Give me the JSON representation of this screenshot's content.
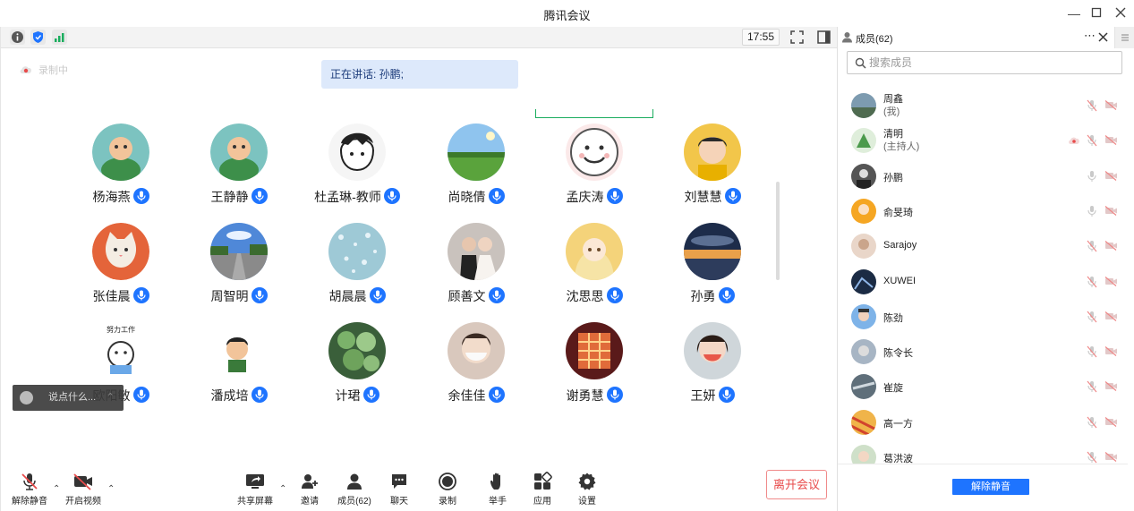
{
  "window": {
    "title": "腾讯会议"
  },
  "topstrip": {
    "time": "17:55"
  },
  "recording": {
    "label": "录制中"
  },
  "speaking": {
    "text": "正在讲话: 孙鹏;"
  },
  "colors": {
    "accent": "#1e74ff",
    "leave": "#e84a4a",
    "speaking_bg": "#dde9fb",
    "active_speaker_border": "#1aad5e"
  },
  "participants": [
    {
      "name": "杨海燕",
      "avatar": "avatar-cartoon-icon"
    },
    {
      "name": "王静静",
      "avatar": "avatar-cartoon-icon"
    },
    {
      "name": "杜孟琳-教师",
      "avatar": "avatar-sketch-icon"
    },
    {
      "name": "尚晓倩",
      "avatar": "avatar-landscape-icon"
    },
    {
      "name": "孟庆涛",
      "avatar": "avatar-smiley-icon"
    },
    {
      "name": "刘慧慧",
      "avatar": "avatar-child-photo-icon"
    },
    {
      "name": "张佳晨",
      "avatar": "avatar-cat-icon"
    },
    {
      "name": "周智明",
      "avatar": "avatar-road-icon"
    },
    {
      "name": "胡晨晨",
      "avatar": "avatar-texture-icon"
    },
    {
      "name": "顾善文",
      "avatar": "avatar-wedding-photo-icon"
    },
    {
      "name": "沈思思",
      "avatar": "avatar-anime-icon"
    },
    {
      "name": "孙勇",
      "avatar": "avatar-sunset-icon"
    },
    {
      "name": "欧阳敏",
      "avatar": "avatar-work-sticker-icon",
      "caption": "努力工作"
    },
    {
      "name": "潘成培",
      "avatar": "avatar-cartoon-man-icon"
    },
    {
      "name": "计珺",
      "avatar": "avatar-plant-icon"
    },
    {
      "name": "余佳佳",
      "avatar": "avatar-mask-photo-icon"
    },
    {
      "name": "谢勇慧",
      "avatar": "avatar-lantern-icon"
    },
    {
      "name": "王妍",
      "avatar": "avatar-woman-photo-icon"
    }
  ],
  "chat_input": {
    "placeholder": "说点什么..."
  },
  "toolbar": {
    "unmute": "解除静音",
    "video": "开启视频",
    "share": "共享屏幕",
    "invite": "邀请",
    "members": "成员(62)",
    "chat": "聊天",
    "record": "录制",
    "raise_hand": "举手",
    "apps": "应用",
    "settings": "设置",
    "leave": "离开会议"
  },
  "panel": {
    "title": "成员(62)",
    "search_placeholder": "搜索成员",
    "unmute_all": "解除静音",
    "members": [
      {
        "name": "周鑫",
        "role": "(我)",
        "mic": "muted",
        "cam": "off"
      },
      {
        "name": "清明",
        "role": "(主持人)",
        "mic": "muted",
        "cam": "off",
        "recording": true
      },
      {
        "name": "孙鹏",
        "mic": "on",
        "cam": "off"
      },
      {
        "name": "俞旻琦",
        "mic": "on",
        "cam": "off"
      },
      {
        "name": "Sarajoy",
        "mic": "muted",
        "cam": "off"
      },
      {
        "name": "XUWEI",
        "mic": "muted",
        "cam": "off"
      },
      {
        "name": "陈劲",
        "mic": "muted",
        "cam": "off"
      },
      {
        "name": "陈令长",
        "mic": "muted",
        "cam": "off"
      },
      {
        "name": "崔旋",
        "mic": "muted",
        "cam": "off"
      },
      {
        "name": "高一方",
        "mic": "muted",
        "cam": "off"
      },
      {
        "name": "葛洪波",
        "mic": "muted",
        "cam": "off"
      }
    ]
  }
}
